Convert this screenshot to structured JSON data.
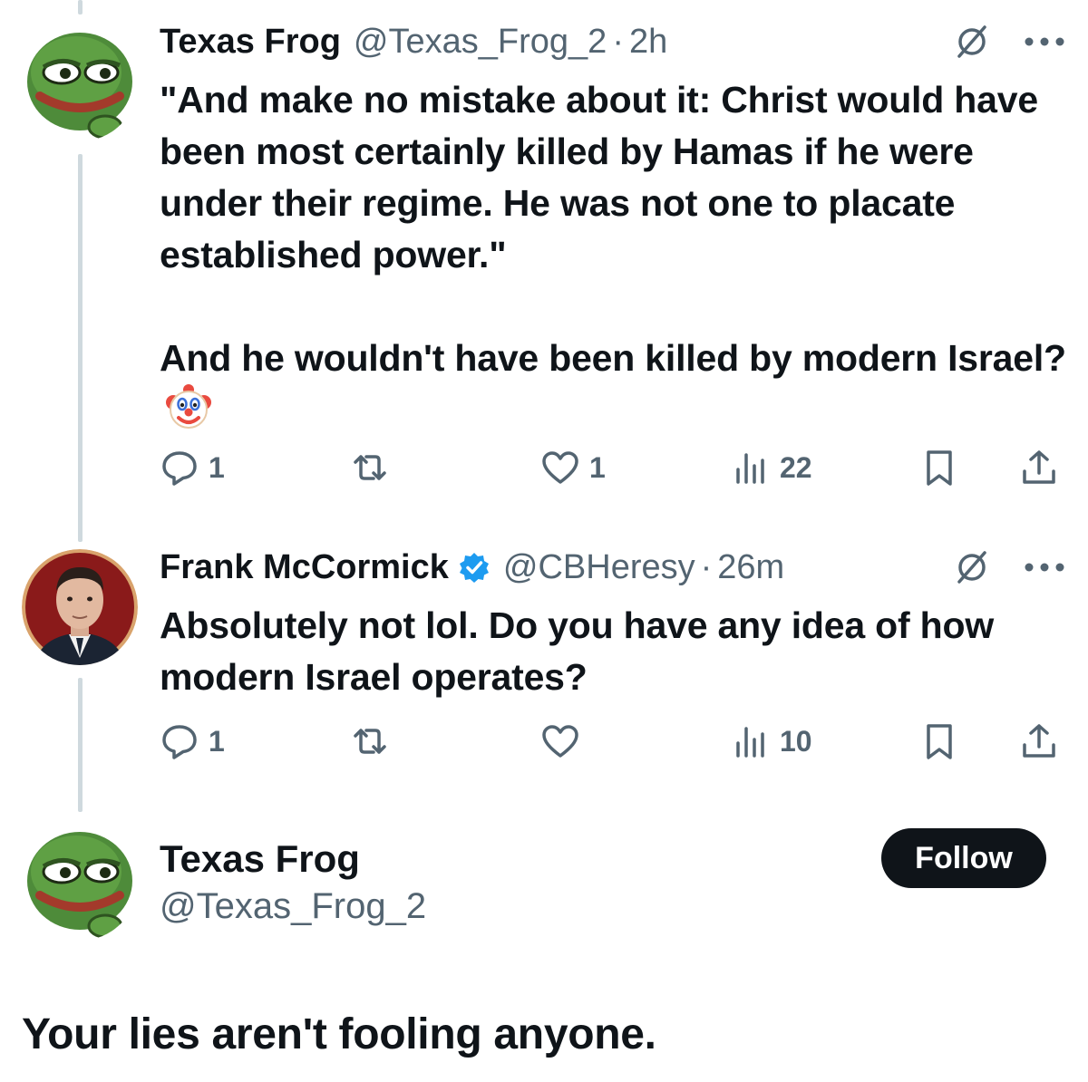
{
  "tweets": [
    {
      "name": "Texas Frog",
      "handle": "@Texas_Frog_2",
      "separator": "·",
      "time": "2h",
      "paragraph1": "\"And make no mistake about it: Christ would have been most certainly killed by Hamas if he were under their regime. He was not one to placate established power.\"",
      "paragraph2": "And he wouldn't have been killed by modern Israel?",
      "emoji": "clown-face",
      "stats": {
        "replies": "1",
        "reposts": "",
        "likes": "1",
        "views": "22"
      }
    },
    {
      "name": "Frank McCormick",
      "verified": true,
      "handle": "@CBHeresy",
      "separator": "·",
      "time": "26m",
      "text": "Absolutely not lol. Do you have any idea of how modern Israel operates?",
      "stats": {
        "replies": "1",
        "reposts": "",
        "likes": "",
        "views": "10"
      }
    }
  ],
  "reply": {
    "name": "Texas Frog",
    "handle": "@Texas_Frog_2",
    "follow_label": "Follow",
    "text": "Your lies aren't fooling anyone."
  },
  "colors": {
    "text": "#0f1419",
    "secondary": "#536471",
    "thread_line": "#cfd9de",
    "verified": "#1d9bf0",
    "button": "#0f1419"
  },
  "icons": [
    "reply-icon",
    "repost-icon",
    "like-icon",
    "views-icon",
    "bookmark-icon",
    "share-icon",
    "grok-icon",
    "more-icon",
    "verified-badge-icon",
    "clown-emoji-icon"
  ]
}
